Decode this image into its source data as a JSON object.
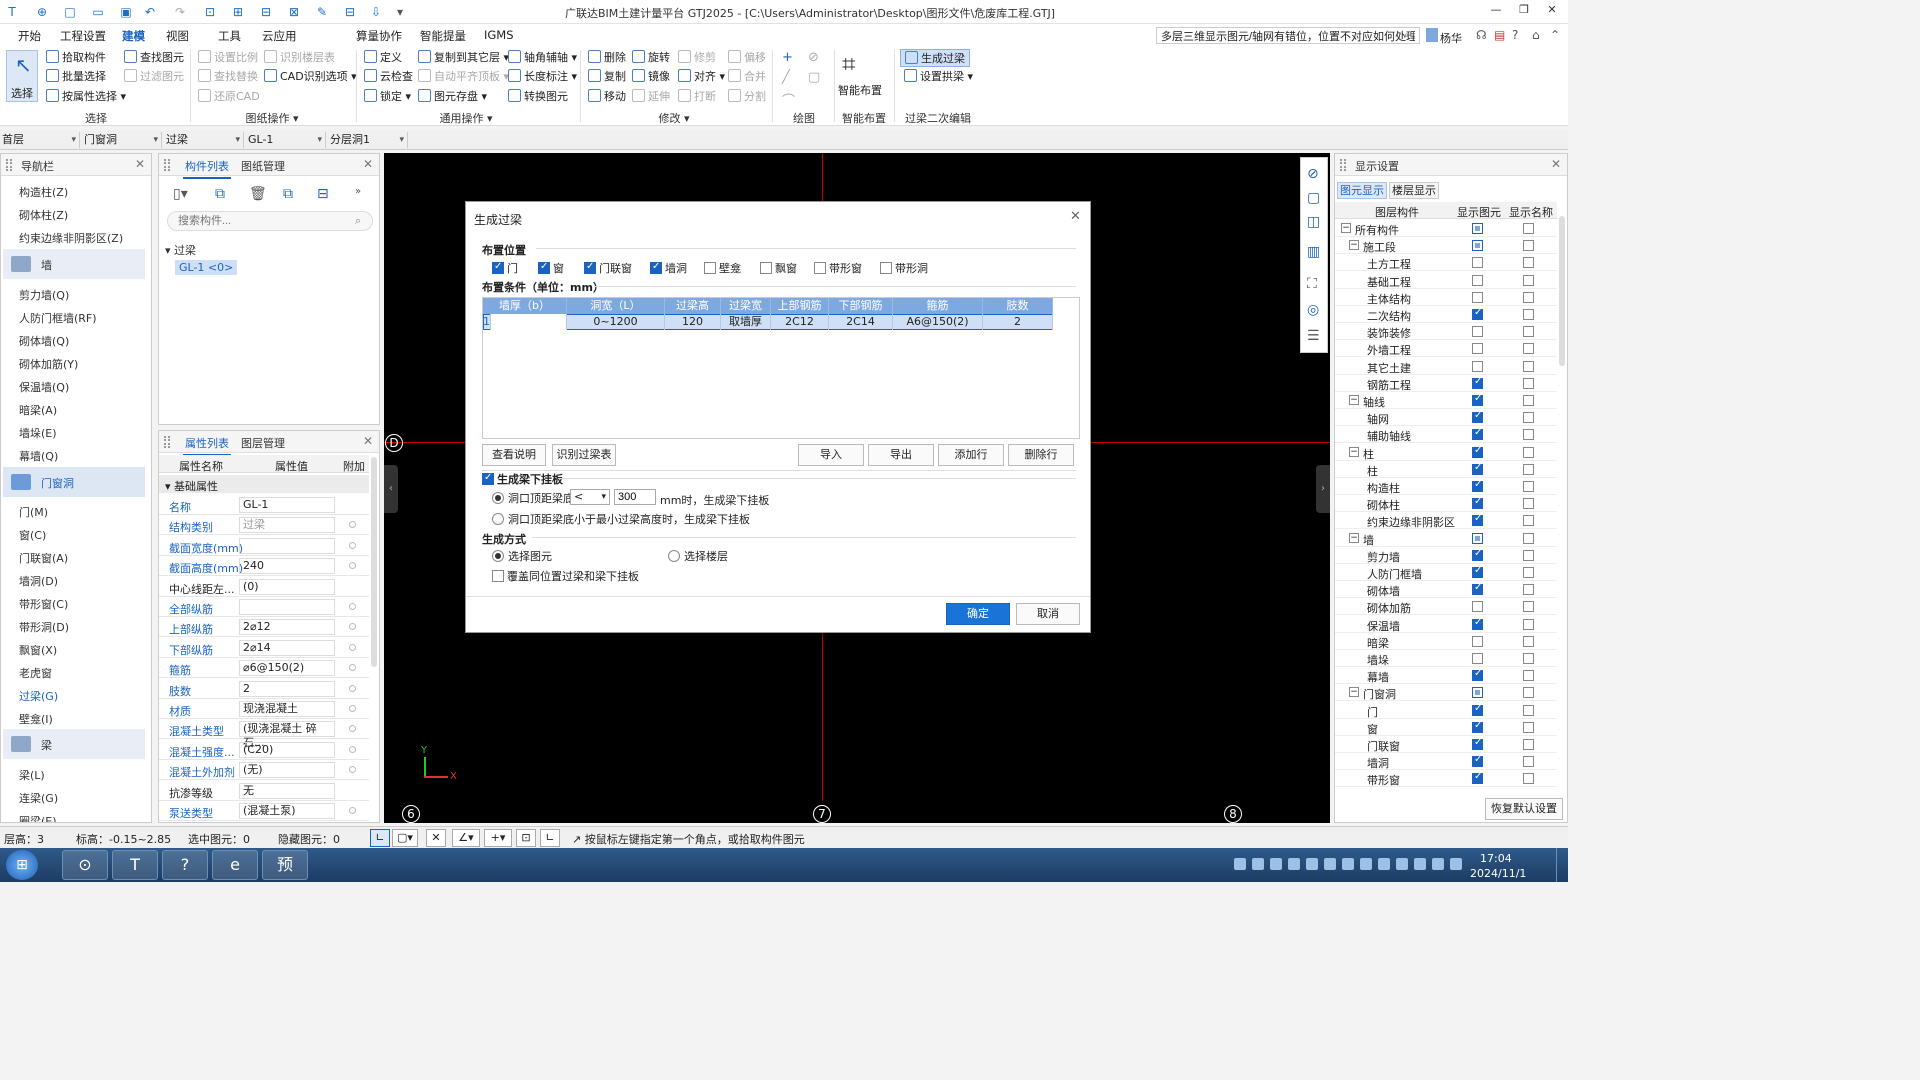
{
  "titlebar": {
    "title": "广联达BIM土建计量平台 GTJ2025 - [C:\\Users\\Administrator\\Desktop\\图形文件\\危废库工程.GTJ]",
    "quick_access": [
      "T",
      "⊕",
      "□",
      "▭",
      "💾",
      "↶",
      "↷",
      "⊡",
      "⊞",
      "⊟",
      "⊠",
      "✎",
      "⇩",
      "▾"
    ],
    "window_controls": {
      "min": "—",
      "restore": "❐",
      "close": "✕"
    }
  },
  "menu": {
    "items": [
      "开始",
      "工程设置",
      "建模",
      "视图",
      "工具",
      "云应用",
      "算量协作",
      "智能提量",
      "IGMS"
    ],
    "active": "建模",
    "help_search": "多层三维显示图元/轴网有错位，位置不对应如何处理？",
    "user": "杨华"
  },
  "ribbon": {
    "select": {
      "label": "选择",
      "items": [
        "拾取构件",
        "批量选择",
        "按属性选择",
        "查找图元",
        "过滤图元"
      ],
      "group": "选择"
    },
    "drawing_ops": {
      "items": [
        "设置比例",
        "查找替换",
        "还原CAD",
        "识别楼层表",
        "CAD识别选项"
      ],
      "group": "图纸操作"
    },
    "common_ops": {
      "items": [
        "定义",
        "云检查",
        "锁定",
        "复制到其它层",
        "自动平齐顶板",
        "图元存盘",
        "轴角辅轴",
        "长度标注",
        "转换图元"
      ],
      "group": "通用操作"
    },
    "modify": {
      "items": [
        "删除",
        "复制",
        "移动",
        "旋转",
        "镜像",
        "延伸",
        "修剪",
        "对齐",
        "打断",
        "偏移",
        "合并",
        "分割"
      ],
      "group": "修改"
    },
    "draw": {
      "group": "绘图"
    },
    "smart_layout": {
      "label": "智能布置",
      "group": "智能布置"
    },
    "lintel_edit": {
      "items": [
        "生成过梁",
        "设置拱梁"
      ],
      "group": "过梁二次编辑"
    }
  },
  "selectors": [
    "首层",
    "门窗洞",
    "过梁",
    "GL-1",
    "分层洞1"
  ],
  "nav": {
    "title": "导航栏",
    "items_top": [
      "构造柱(Z)",
      "砌体柱(Z)",
      "约束边缘非阴影区(Z)"
    ],
    "group_wall": "墙",
    "items_wall": [
      "剪力墙(Q)",
      "人防门框墙(RF)",
      "砌体墙(Q)",
      "砌体加筋(Y)",
      "保温墙(Q)",
      "暗梁(A)",
      "墙垛(E)",
      "幕墙(Q)"
    ],
    "group_door": "门窗洞",
    "items_door": [
      "门(M)",
      "窗(C)",
      "门联窗(A)",
      "墙洞(D)",
      "带形窗(C)",
      "带形洞(D)",
      "飘窗(X)",
      "老虎窗",
      "过梁(G)",
      "壁龛(I)"
    ],
    "group_beam": "梁",
    "items_beam": [
      "梁(L)",
      "连梁(G)",
      "圈梁(E)"
    ]
  },
  "component_list": {
    "tabs": [
      "构件列表",
      "图纸管理"
    ],
    "search_placeholder": "搜索构件...",
    "tree_parent": "过梁",
    "tree_child": "GL-1 <0>"
  },
  "properties": {
    "tabs": [
      "属性列表",
      "图层管理"
    ],
    "headers": [
      "属性名称",
      "属性值",
      "附加"
    ],
    "section": "基础属性",
    "rows": [
      {
        "name": "名称",
        "value": "GL-1",
        "blue": true
      },
      {
        "name": "结构类别",
        "value": "过梁",
        "blue": true
      },
      {
        "name": "截面宽度(mm)",
        "value": "",
        "blue": true
      },
      {
        "name": "截面高度(mm)",
        "value": "240",
        "blue": true
      },
      {
        "name": "中心线距左...",
        "value": "(0)",
        "blue": false
      },
      {
        "name": "全部纵筋",
        "value": "",
        "blue": true
      },
      {
        "name": "上部纵筋",
        "value": "2⌀12",
        "blue": true
      },
      {
        "name": "下部纵筋",
        "value": "2⌀14",
        "blue": true
      },
      {
        "name": "箍筋",
        "value": "⌀6@150(2)",
        "blue": true
      },
      {
        "name": "肢数",
        "value": "2",
        "blue": true
      },
      {
        "name": "材质",
        "value": "现浇混凝土",
        "blue": true
      },
      {
        "name": "混凝土类型",
        "value": "(现浇混凝土 碎石...",
        "blue": true
      },
      {
        "name": "混凝土强度...",
        "value": "(C20)",
        "blue": true
      },
      {
        "name": "混凝土外加剂",
        "value": "(无)",
        "blue": true
      },
      {
        "name": "抗渗等级",
        "value": "无",
        "blue": false
      },
      {
        "name": "泵送类型",
        "value": "(混凝土泵)",
        "blue": true
      }
    ]
  },
  "canvas": {
    "axis_labels": {
      "row": "D",
      "col1": "6",
      "col2": "7",
      "col3": "8"
    },
    "coord_y": "Y",
    "coord_x": "X"
  },
  "dialog": {
    "title": "生成过梁",
    "position_label": "布置位置",
    "positions": [
      {
        "label": "门",
        "checked": true
      },
      {
        "label": "窗",
        "checked": true
      },
      {
        "label": "门联窗",
        "checked": true
      },
      {
        "label": "墙洞",
        "checked": true
      },
      {
        "label": "壁龛",
        "checked": false
      },
      {
        "label": "飘窗",
        "checked": false
      },
      {
        "label": "带形窗",
        "checked": false
      },
      {
        "label": "带形洞",
        "checked": false
      }
    ],
    "condition_label": "布置条件（单位：mm）",
    "table_headers": [
      "墙厚（b）",
      "洞宽（L）",
      "过梁高",
      "过梁宽",
      "上部钢筋",
      "下部钢筋",
      "箍筋",
      "肢数"
    ],
    "table_rows": [
      {
        "index": "1",
        "cells": [
          "",
          "0~1200",
          "120",
          "取墙厚",
          "2C12",
          "2C14",
          "A6@150(2)",
          "2"
        ]
      }
    ],
    "buttons_left": [
      "查看说明",
      "识别过梁表"
    ],
    "buttons_right": [
      "导入",
      "导出",
      "添加行",
      "删除行"
    ],
    "gen_hanger_label": "生成梁下挂板",
    "gen_hanger_checked": true,
    "opt1_prefix": "洞口顶距梁底",
    "opt1_operator": "<",
    "opt1_value": "300",
    "opt1_suffix": "mm时，生成梁下挂板",
    "opt2": "洞口顶距梁底小于最小过梁高度时，生成梁下挂板",
    "gen_method_label": "生成方式",
    "method_select": "选择图元",
    "method_floor": "选择楼层",
    "overwrite_label": "覆盖同位置过梁和梁下挂板",
    "ok": "确定",
    "cancel": "取消"
  },
  "display_settings": {
    "title": "显示设置",
    "tabs": [
      "图元显示",
      "楼层显示"
    ],
    "headers": [
      "图层构件",
      "显示图元",
      "显示名称"
    ],
    "rows": [
      {
        "label": "所有构件",
        "level": 0,
        "tog": "−",
        "show": "part",
        "name": false
      },
      {
        "label": "施工段",
        "level": 1,
        "tog": "−",
        "show": "part",
        "name": false
      },
      {
        "label": "土方工程",
        "level": 2,
        "show": false,
        "name": false
      },
      {
        "label": "基础工程",
        "level": 2,
        "show": false,
        "name": false
      },
      {
        "label": "主体结构",
        "level": 2,
        "show": false,
        "name": false
      },
      {
        "label": "二次结构",
        "level": 2,
        "show": true,
        "name": false
      },
      {
        "label": "装饰装修",
        "level": 2,
        "show": false,
        "name": false
      },
      {
        "label": "外墙工程",
        "level": 2,
        "show": false,
        "name": false
      },
      {
        "label": "其它土建",
        "level": 2,
        "show": false,
        "name": false
      },
      {
        "label": "钢筋工程",
        "level": 2,
        "show": true,
        "name": false
      },
      {
        "label": "轴线",
        "level": 1,
        "tog": "−",
        "show": true,
        "name": false
      },
      {
        "label": "轴网",
        "level": 2,
        "show": true,
        "name": false
      },
      {
        "label": "辅助轴线",
        "level": 2,
        "show": true,
        "name": false
      },
      {
        "label": "柱",
        "level": 1,
        "tog": "−",
        "show": true,
        "name": false
      },
      {
        "label": "柱",
        "level": 2,
        "show": true,
        "name": false
      },
      {
        "label": "构造柱",
        "level": 2,
        "show": true,
        "name": false
      },
      {
        "label": "砌体柱",
        "level": 2,
        "show": true,
        "name": false
      },
      {
        "label": "约束边缘非阴影区",
        "level": 2,
        "show": true,
        "name": false
      },
      {
        "label": "墙",
        "level": 1,
        "tog": "−",
        "show": "part",
        "name": false
      },
      {
        "label": "剪力墙",
        "level": 2,
        "show": true,
        "name": false
      },
      {
        "label": "人防门框墙",
        "level": 2,
        "show": true,
        "name": false
      },
      {
        "label": "砌体墙",
        "level": 2,
        "show": true,
        "name": false
      },
      {
        "label": "砌体加筋",
        "level": 2,
        "show": false,
        "name": false
      },
      {
        "label": "保温墙",
        "level": 2,
        "show": true,
        "name": false
      },
      {
        "label": "暗梁",
        "level": 2,
        "show": false,
        "name": false
      },
      {
        "label": "墙垛",
        "level": 2,
        "show": false,
        "name": false
      },
      {
        "label": "幕墙",
        "level": 2,
        "show": true,
        "name": false
      },
      {
        "label": "门窗洞",
        "level": 1,
        "tog": "−",
        "show": "part",
        "name": false
      },
      {
        "label": "门",
        "level": 2,
        "show": true,
        "name": false
      },
      {
        "label": "窗",
        "level": 2,
        "show": true,
        "name": false
      },
      {
        "label": "门联窗",
        "level": 2,
        "show": true,
        "name": false
      },
      {
        "label": "墙洞",
        "level": 2,
        "show": true,
        "name": false
      },
      {
        "label": "带形窗",
        "level": 2,
        "show": true,
        "name": false
      }
    ],
    "restore_button": "恢复默认设置"
  },
  "status": {
    "floor": "层高：3",
    "elevation": "标高：-0.15~2.85",
    "selected": "选中图元：0",
    "hidden": "隐藏图元：0",
    "hint": "按鼠标左键指定第一个角点，或拾取构件图元"
  },
  "taskbar": {
    "time": "17:04",
    "date": "2024/11/1",
    "apps": [
      "⊙",
      "T",
      "?",
      "e",
      "预"
    ]
  }
}
